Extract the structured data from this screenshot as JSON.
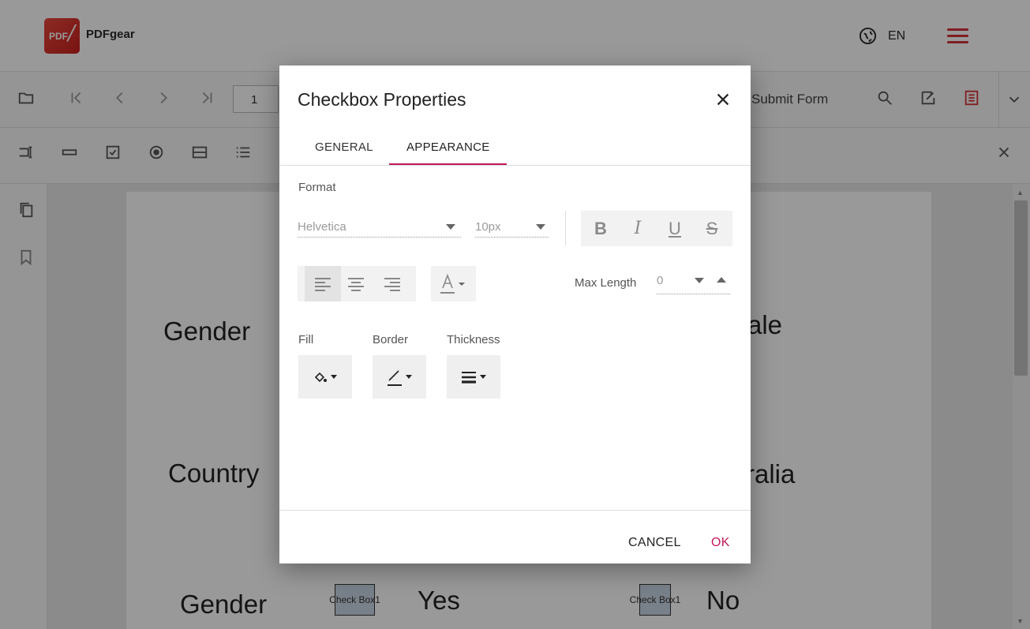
{
  "app": {
    "brand": "PDFgear",
    "logo_text": "PDF",
    "language": "EN"
  },
  "toolbar": {
    "page_number": "1",
    "submit_form": "Submit Form"
  },
  "document": {
    "labels": [
      "Gender",
      "ale",
      "Country",
      "ralia",
      "Gender",
      "Yes",
      "No"
    ],
    "checkbox_1": "Check Box1",
    "checkbox_2": "Check Box1"
  },
  "dialog": {
    "title": "Checkbox Properties",
    "tabs": [
      {
        "label": "GENERAL",
        "active": false
      },
      {
        "label": "APPEARANCE",
        "active": true
      }
    ],
    "format_label": "Format",
    "font_family": "Helvetica",
    "font_size": "10px",
    "style_buttons": [
      "B",
      "I",
      "U",
      "S"
    ],
    "max_length_label": "Max Length",
    "max_length_value": "0",
    "fill_label": "Fill",
    "border_label": "Border",
    "thickness_label": "Thickness",
    "cancel_label": "CANCEL",
    "ok_label": "OK"
  },
  "colors": {
    "accent": "#c2185b",
    "brand_red": "#d5333a"
  },
  "icons": [
    "globe-icon",
    "hamburger-menu-icon",
    "folder-icon",
    "first-page-icon",
    "prev-page-icon",
    "next-page-icon",
    "last-page-icon",
    "search-icon",
    "edit-form-icon",
    "form-fields-icon",
    "chevron-down-icon",
    "close-icon",
    "align-left-icon",
    "align-center-icon",
    "align-right-icon",
    "font-color-icon",
    "fill-color-icon",
    "border-color-icon",
    "thickness-icon"
  ]
}
